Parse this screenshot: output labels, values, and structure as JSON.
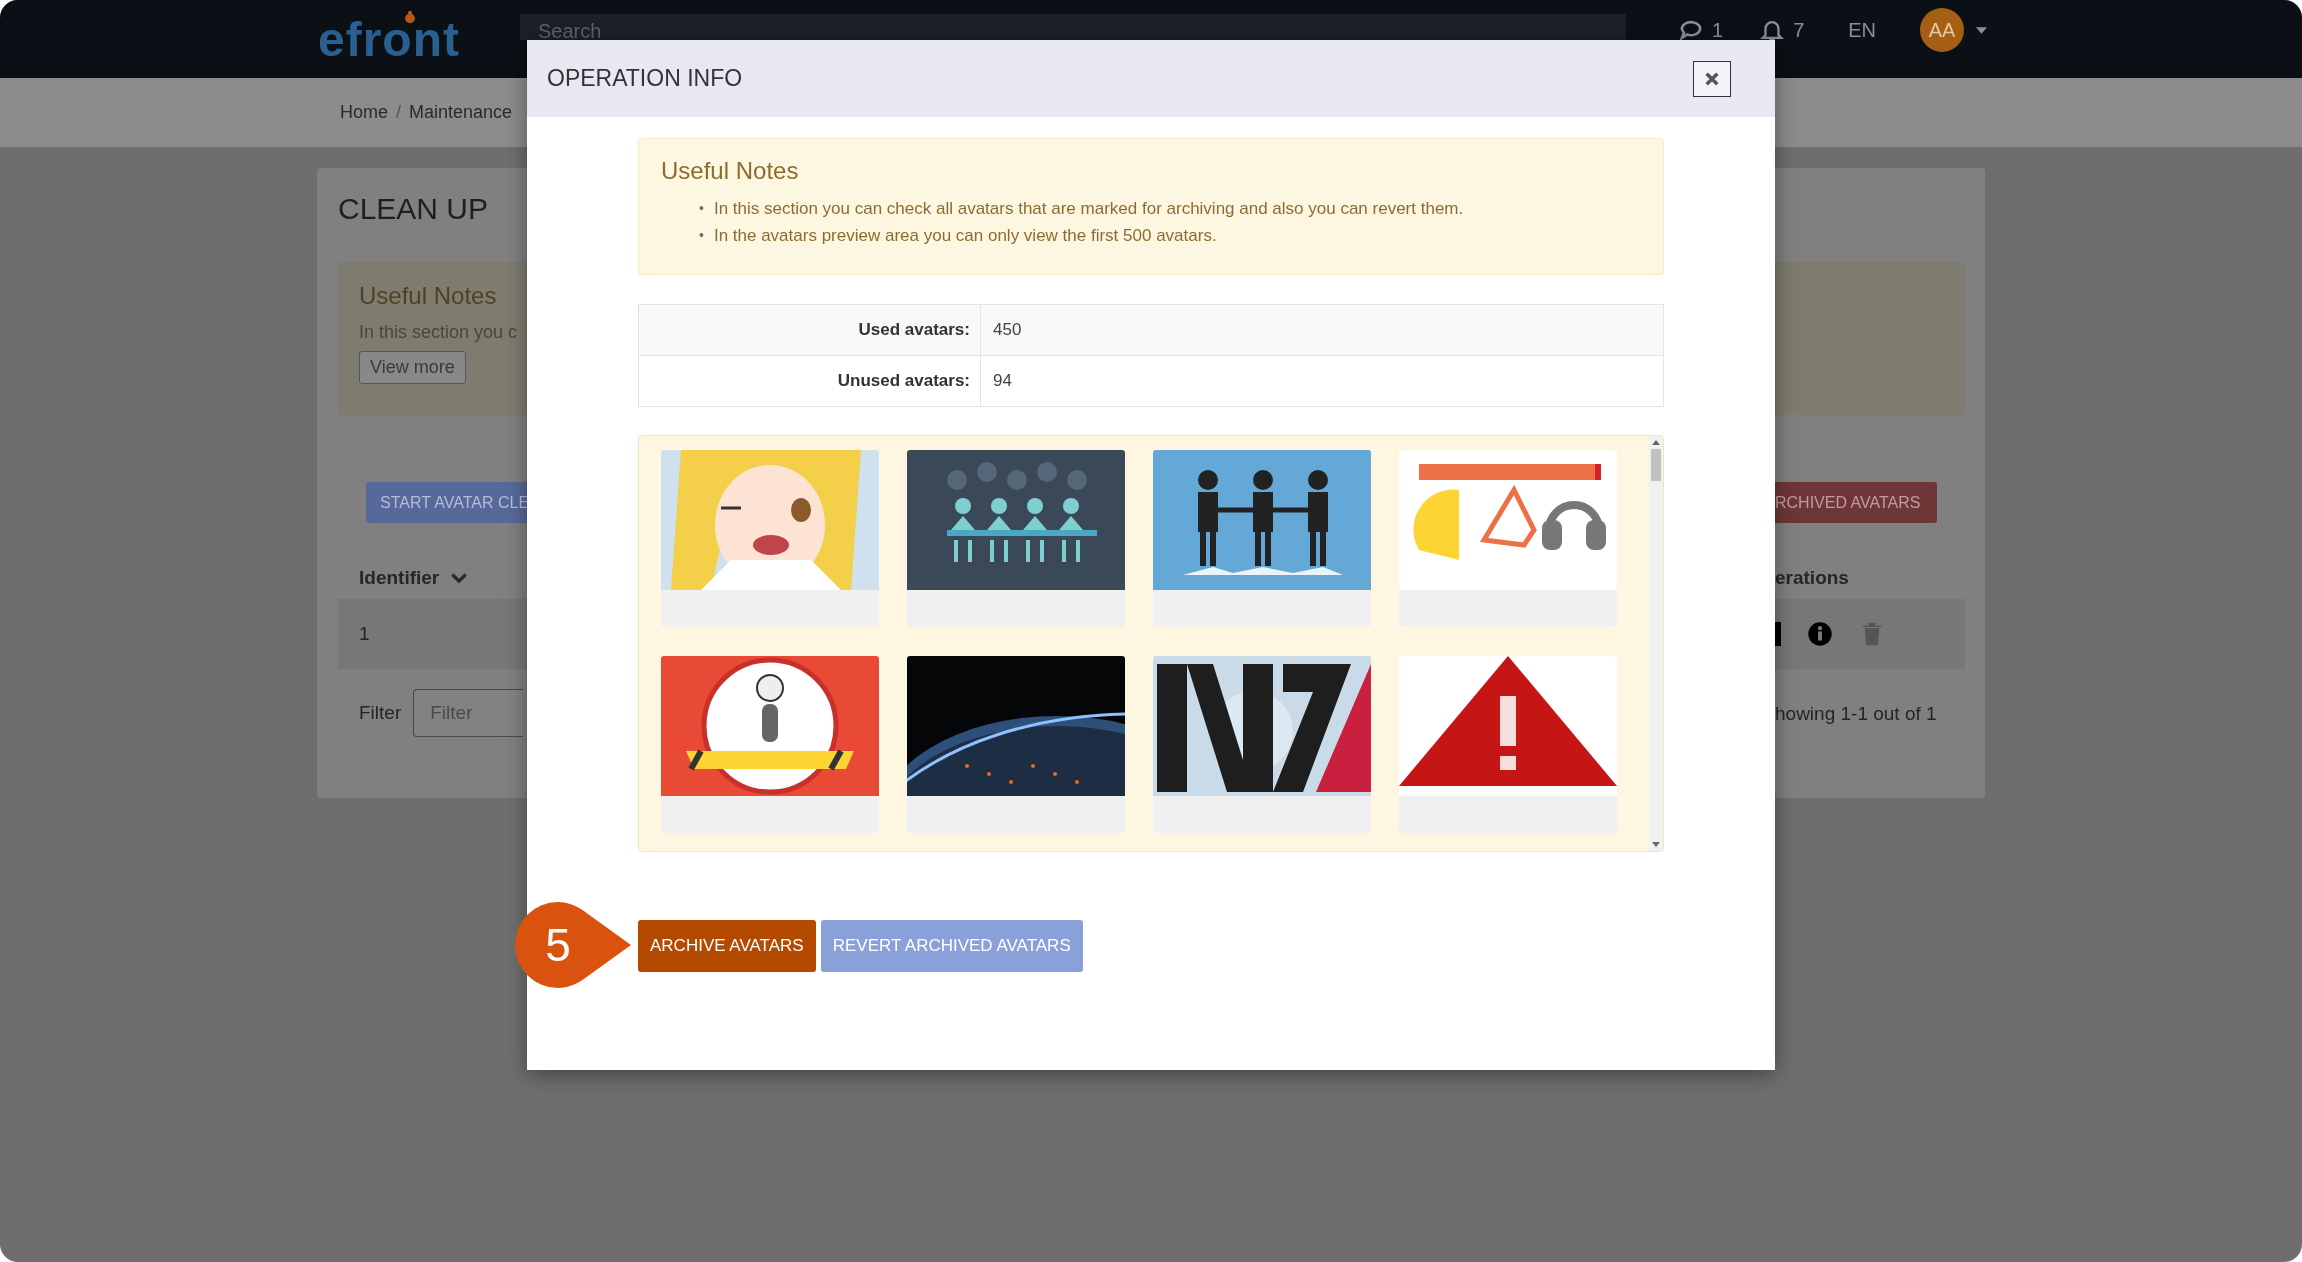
{
  "topbar": {
    "logo": "efront",
    "search": {
      "placeholder": "Search"
    },
    "messages_count": "1",
    "notifications_count": "7",
    "language": "EN",
    "user_initials": "AA"
  },
  "breadcrumb": {
    "separator": "/",
    "items": [
      "Home",
      "Maintenance"
    ]
  },
  "page": {
    "title": "CLEAN UP",
    "notes": {
      "title": "Useful Notes",
      "text": "In this section you c",
      "button": "View more"
    },
    "buttons": [
      {
        "label": "START AVATAR CLE",
        "kind": "primary"
      },
      {
        "label": "RCHIVED AVATARS",
        "kind": "danger"
      }
    ],
    "columns": [
      "Identifier",
      "erations"
    ],
    "rows": [
      {
        "identifier": "1"
      }
    ],
    "filter": {
      "label": "Filter",
      "placeholder": "Filter"
    },
    "pagination": "howing 1-1 out of 1"
  },
  "modal": {
    "title": "OPERATION INFO",
    "notes": {
      "title": "Useful Notes",
      "items": [
        {
          "bullet": "•",
          "text": "In this section you can check all avatars that are marked for archiving and also you can revert them."
        },
        {
          "bullet": "•",
          "text": "In the avatars preview area you can only view the first 500 avatars."
        }
      ]
    },
    "stats": [
      {
        "label": "Used avatars:",
        "value": "450"
      },
      {
        "label": "Unused avatars:",
        "value": "94"
      }
    ],
    "avatars": [
      {
        "kind": "anime"
      },
      {
        "kind": "meeting"
      },
      {
        "kind": "handshake"
      },
      {
        "kind": "ppe"
      },
      {
        "kind": "safety"
      },
      {
        "kind": "earth"
      },
      {
        "kind": "n7"
      },
      {
        "kind": "warning"
      }
    ],
    "buttons": [
      {
        "label": "ARCHIVE AVATARS",
        "kind": "archive"
      },
      {
        "label": "REVERT ARCHIVED AVATARS",
        "kind": "revert"
      }
    ],
    "step_badge": "5"
  }
}
